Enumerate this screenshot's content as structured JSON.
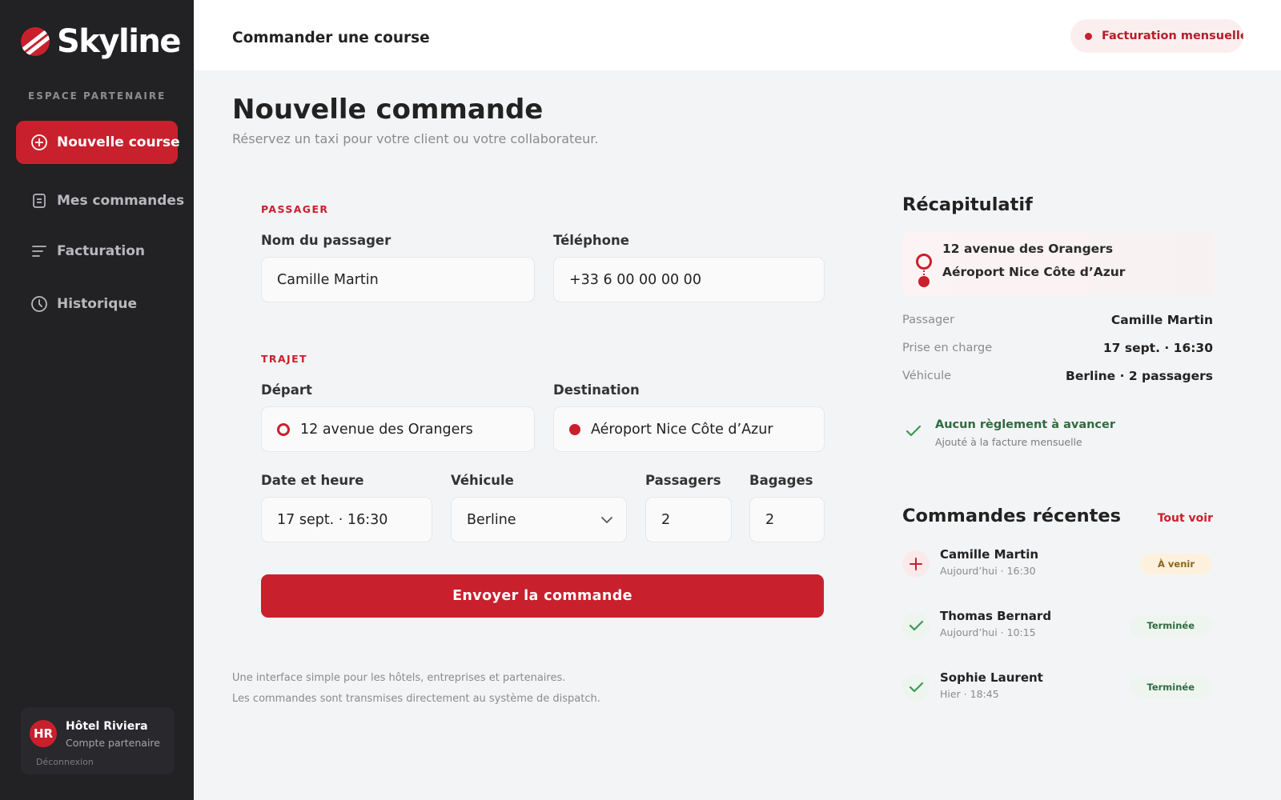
{
  "brand": {
    "name": "Skyline",
    "section": "ESPACE PARTENAIRE"
  },
  "sidebar": {
    "items": [
      {
        "label": "Nouvelle course",
        "icon": "plus-circle-icon"
      },
      {
        "label": "Mes commandes",
        "icon": "document-icon"
      },
      {
        "label": "Facturation",
        "icon": "lines-icon"
      },
      {
        "label": "Historique",
        "icon": "clock-icon"
      }
    ],
    "partner": {
      "initials": "HR",
      "name": "Hôtel Riviera",
      "role": "Compte partenaire",
      "logout": "Déconnexion"
    }
  },
  "header": {
    "title": "Commander une course",
    "billing": "Facturation mensuelle"
  },
  "page": {
    "title": "Nouvelle commande",
    "subtitle": "Réservez un taxi pour votre client ou votre collaborateur."
  },
  "form": {
    "passenger_section": "PASSAGER",
    "name_label": "Nom du passager",
    "name_value": "Camille Martin",
    "phone_label": "Téléphone",
    "phone_value": "+33 6 00 00 00 00",
    "route_section": "TRAJET",
    "departure_label": "Départ",
    "departure_value": "12 avenue des Orangers",
    "destination_label": "Destination",
    "destination_value": "Aéroport Nice Côte d’Azur",
    "datetime_label": "Date et heure",
    "datetime_value": "17 sept. · 16:30",
    "vehicle_label": "Véhicule",
    "vehicle_value": "Berline",
    "passengers_label": "Passagers",
    "passengers_value": "2",
    "luggage_label": "Bagages",
    "luggage_value": "2",
    "submit": "Envoyer la commande"
  },
  "footnotes": [
    "Une interface simple pour les hôtels, entreprises et partenaires.",
    "Les commandes sont transmises directement au système de dispatch."
  ],
  "summary": {
    "title": "Récapitulatif",
    "from": "12 avenue des Orangers",
    "to": "Aéroport Nice Côte d’Azur",
    "rows": [
      {
        "label": "Passager",
        "value": "Camille Martin"
      },
      {
        "label": "Prise en charge",
        "value": "17 sept. · 16:30"
      },
      {
        "label": "Véhicule",
        "value": "Berline · 2 passagers"
      }
    ],
    "payment_title": "Aucun règlement à avancer",
    "payment_sub": "Ajouté à la facture mensuelle"
  },
  "recent": {
    "title": "Commandes récentes",
    "see_all": "Tout voir",
    "orders": [
      {
        "name": "Camille Martin",
        "time": "Aujourd’hui · 16:30",
        "status": "À venir",
        "icon": "plus-icon"
      },
      {
        "name": "Thomas Bernard",
        "time": "Aujourd’hui · 10:15",
        "status": "Terminée",
        "icon": "check-icon"
      },
      {
        "name": "Sophie Laurent",
        "time": "Hier · 18:45",
        "status": "Terminée",
        "icon": "check-icon"
      }
    ]
  },
  "colors": {
    "accent": "#c9202d",
    "sidebar": "#222124",
    "success": "#2f6b3f"
  }
}
